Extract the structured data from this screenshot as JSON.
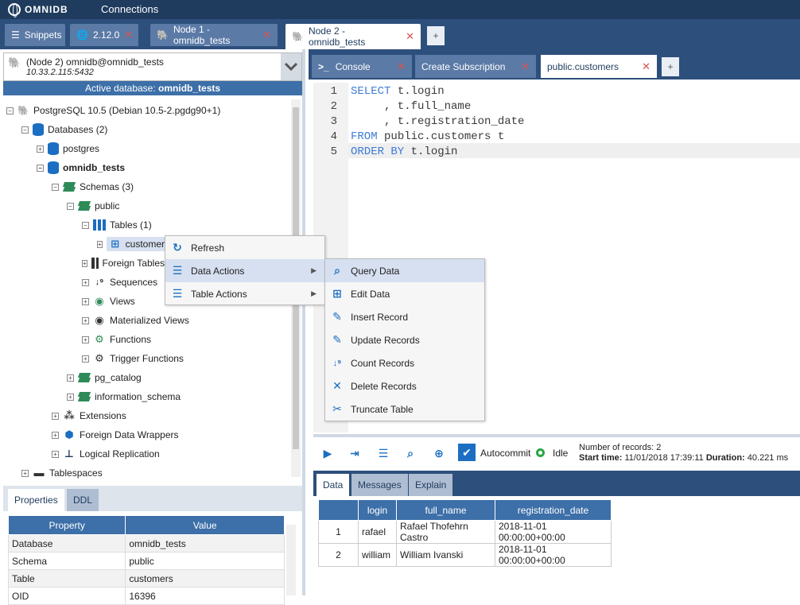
{
  "app": {
    "brand": "OMNIDB",
    "section": "Connections"
  },
  "outer_tabs": [
    {
      "label": "Snippets",
      "icon": "list-icon",
      "closable": false
    },
    {
      "label": "2.12.0",
      "icon": "globe-icon",
      "closable": true
    },
    {
      "label": "Node 1 - omnidb_tests",
      "icon": "postgres-icon",
      "closable": true
    },
    {
      "label": "Node 2 - omnidb_tests",
      "icon": "postgres-icon",
      "closable": true,
      "active": true
    }
  ],
  "connection": {
    "title": "(Node 2) omnidb@omnidb_tests",
    "address": "10.33.2.115:5432",
    "active_db_label": "Active database:",
    "active_db": "omnidb_tests"
  },
  "tree": [
    {
      "label": "PostgreSQL 10.5 (Debian 10.5-2.pgdg90+1)",
      "icon": "postgres-icon",
      "level": 0,
      "exp": "-"
    },
    {
      "label": "Databases (2)",
      "icon": "database-icon",
      "level": 1,
      "exp": "-"
    },
    {
      "label": "postgres",
      "icon": "database-icon",
      "level": 2,
      "exp": "+"
    },
    {
      "label": "omnidb_tests",
      "icon": "database-icon",
      "level": 2,
      "exp": "-",
      "bold": true
    },
    {
      "label": "Schemas (3)",
      "icon": "layers-icon",
      "level": 3,
      "exp": "-"
    },
    {
      "label": "public",
      "icon": "layers-icon",
      "level": 4,
      "exp": "-"
    },
    {
      "label": "Tables (1)",
      "icon": "table-grid-icon",
      "level": 5,
      "exp": "-"
    },
    {
      "label": "customers",
      "icon": "table-icon",
      "level": 6,
      "exp": "+",
      "selected": true
    },
    {
      "label": "Foreign Tables",
      "icon": "table-grid-icon",
      "level": 5,
      "exp": "+"
    },
    {
      "label": "Sequences",
      "icon": "sort-numeric-icon",
      "level": 5,
      "exp": "+"
    },
    {
      "label": "Views",
      "icon": "eye-icon",
      "level": 5,
      "exp": "+"
    },
    {
      "label": "Materialized Views",
      "icon": "eye-icon",
      "level": 5,
      "exp": "+"
    },
    {
      "label": "Functions",
      "icon": "gear-icon",
      "level": 5,
      "exp": "+"
    },
    {
      "label": "Trigger Functions",
      "icon": "gear-icon",
      "level": 5,
      "exp": "+"
    },
    {
      "label": "pg_catalog",
      "icon": "layers-icon",
      "level": 4,
      "exp": "+"
    },
    {
      "label": "information_schema",
      "icon": "layers-icon",
      "level": 4,
      "exp": "+"
    },
    {
      "label": "Extensions",
      "icon": "cubes-icon",
      "level": 3,
      "exp": "+"
    },
    {
      "label": "Foreign Data Wrappers",
      "icon": "cube-icon",
      "level": 3,
      "exp": "+"
    },
    {
      "label": "Logical Replication",
      "icon": "sitemap-icon",
      "level": 3,
      "exp": "+"
    },
    {
      "label": "Tablespaces",
      "icon": "folder-icon",
      "level": 1,
      "exp": "+"
    }
  ],
  "context_menu": [
    {
      "label": "Refresh",
      "icon": "refresh-icon"
    },
    {
      "label": "Data Actions",
      "icon": "list-icon",
      "submenu": true,
      "highlighted": true
    },
    {
      "label": "Table Actions",
      "icon": "list-icon",
      "submenu": true
    }
  ],
  "submenu": [
    {
      "label": "Query Data",
      "icon": "search-icon",
      "highlighted": true
    },
    {
      "label": "Edit Data",
      "icon": "table-icon"
    },
    {
      "label": "Insert Record",
      "icon": "edit-icon"
    },
    {
      "label": "Update Records",
      "icon": "edit-icon"
    },
    {
      "label": "Count Records",
      "icon": "sort-numeric-icon"
    },
    {
      "label": "Delete Records",
      "icon": "close-icon"
    },
    {
      "label": "Truncate Table",
      "icon": "scissors-icon"
    }
  ],
  "properties": {
    "tabs": [
      "Properties",
      "DDL"
    ],
    "headers": [
      "Property",
      "Value"
    ],
    "rows": [
      [
        "Database",
        "omnidb_tests"
      ],
      [
        "Schema",
        "public"
      ],
      [
        "Table",
        "customers"
      ],
      [
        "OID",
        "16396"
      ]
    ]
  },
  "inner_tabs": [
    {
      "label": "Console",
      "icon": "terminal-icon",
      "closable": true
    },
    {
      "label": "Create Subscription",
      "closable": true
    },
    {
      "label": "public.customers",
      "closable": true,
      "active": true
    }
  ],
  "editor": {
    "lines": [
      [
        {
          "t": "SELECT",
          "kw": true
        },
        {
          "t": " t.login"
        }
      ],
      [
        {
          "t": "     , t.full_name"
        }
      ],
      [
        {
          "t": "     , t.registration_date"
        }
      ],
      [
        {
          "t": "FROM",
          "kw": true
        },
        {
          "t": " public.customers t"
        }
      ],
      [
        {
          "t": "ORDER BY",
          "kw": true
        },
        {
          "t": " t.login"
        }
      ]
    ]
  },
  "run_toolbar": {
    "autocommit_label": "Autocommit",
    "status": "Idle",
    "records_label": "Number of records:",
    "records": "2",
    "start_label": "Start time:",
    "start_time": "11/01/2018 17:39:11",
    "duration_label": "Duration:",
    "duration": "40.221 ms"
  },
  "result_tabs": [
    "Data",
    "Messages",
    "Explain"
  ],
  "result": {
    "headers": [
      "",
      "login",
      "full_name",
      "registration_date"
    ],
    "rows": [
      [
        "1",
        "rafael",
        "Rafael Thofehrn Castro",
        "2018-11-01 00:00:00+00:00"
      ],
      [
        "2",
        "william",
        "William Ivanski",
        "2018-11-01 00:00:00+00:00"
      ]
    ]
  },
  "colors": {
    "topbar": "#1f3b5e",
    "tabbar": "#2d4f7c",
    "accent": "#3d6fa8",
    "keyword": "#3d7bd8"
  }
}
